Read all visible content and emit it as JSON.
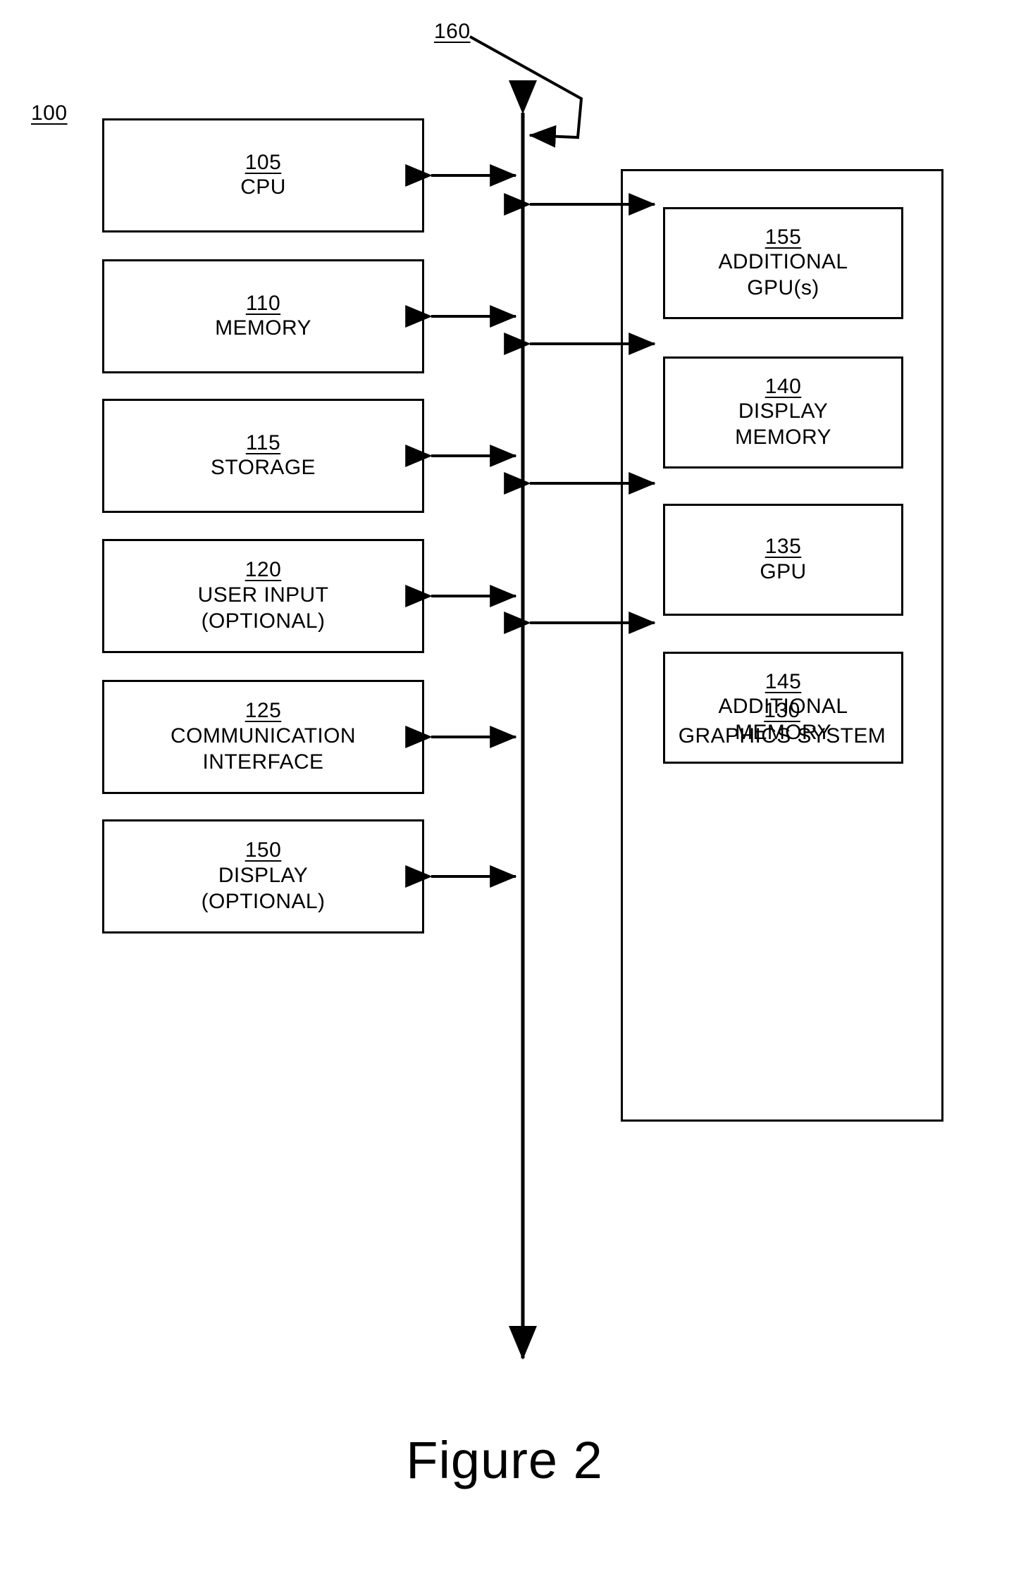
{
  "figure": {
    "caption": "Figure 2",
    "system_ref": "100",
    "bus_ref": "160"
  },
  "left_column": [
    {
      "num": "105",
      "lines": [
        "CPU"
      ]
    },
    {
      "num": "110",
      "lines": [
        "MEMORY"
      ]
    },
    {
      "num": "115",
      "lines": [
        "STORAGE"
      ]
    },
    {
      "num": "120",
      "lines": [
        "USER INPUT",
        "(OPTIONAL)"
      ]
    },
    {
      "num": "125",
      "lines": [
        "COMMUNICATION",
        "INTERFACE"
      ]
    },
    {
      "num": "150",
      "lines": [
        "DISPLAY",
        "(OPTIONAL)"
      ]
    }
  ],
  "graphics_system": {
    "num": "130",
    "label": "GRAPHICS SYSTEM",
    "components": [
      {
        "num": "155",
        "lines": [
          "ADDITIONAL",
          "GPU(s)"
        ]
      },
      {
        "num": "140",
        "lines": [
          "DISPLAY",
          "MEMORY"
        ]
      },
      {
        "num": "135",
        "lines": [
          "GPU"
        ]
      },
      {
        "num": "145",
        "lines": [
          "ADDITIONAL",
          "MEMORY"
        ]
      }
    ]
  },
  "colors": {
    "stroke": "#000000",
    "background": "#ffffff"
  }
}
